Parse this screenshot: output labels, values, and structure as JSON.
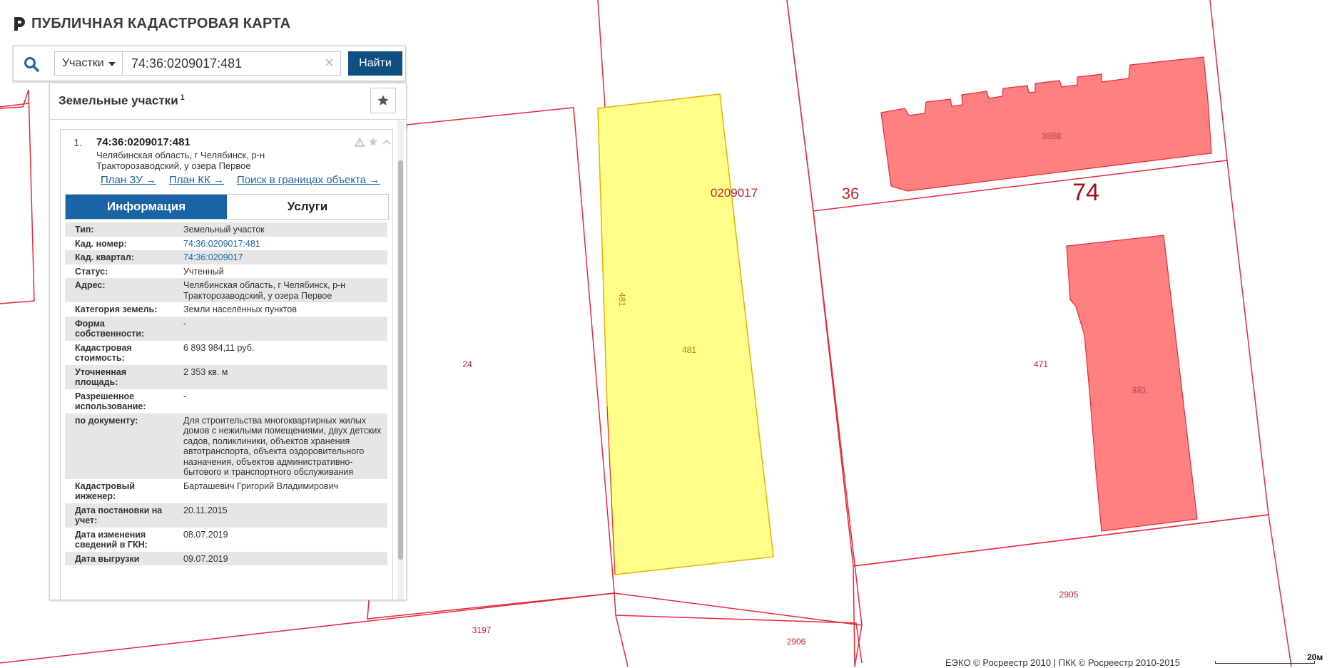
{
  "app": {
    "title": "ПУБЛИЧНАЯ КАДАСТРОВАЯ КАРТА"
  },
  "search": {
    "type_label": "Участки",
    "query": "74:36:0209017:481",
    "clear_symbol": "×",
    "find_label": "Найти"
  },
  "panel": {
    "title": "Земельные участки",
    "count": "1",
    "result": {
      "number": "1.",
      "cad_number": "74:36:0209017:481",
      "address": "Челябинская область, г Челябинск, р-н Тракторозаводский, у озера Первое",
      "links": [
        "План ЗУ →",
        "План КК →",
        "Поиск в границах объекта →"
      ]
    },
    "tabs": [
      {
        "label": "Информация",
        "active": true
      },
      {
        "label": "Услуги",
        "active": false
      }
    ],
    "info": [
      {
        "k": "Тип:",
        "v": "Земельный участок"
      },
      {
        "k": "Кад. номер:",
        "v": "74:36:0209017:481",
        "link": true
      },
      {
        "k": "Кад. квартал:",
        "v": "74:36:0209017",
        "link": true
      },
      {
        "k": "Статус:",
        "v": "Учтенный"
      },
      {
        "k": "Адрес:",
        "v": "Челябинская область, г Челябинск, р-н Тракторозаводский, у озера Первое"
      },
      {
        "k": "Категория земель:",
        "v": "Земли населённых пунктов"
      },
      {
        "k": "Форма собственности:",
        "v": "-"
      },
      {
        "k": "Кадастровая стоимость:",
        "v": "6 893 984,11 руб."
      },
      {
        "k": "Уточненная площадь:",
        "v": "2 353 кв. м"
      },
      {
        "k": "Разрешенное использование:",
        "v": "-"
      },
      {
        "k": "по документу:",
        "v": "Для строительства многоквартирных жилых домов с нежилыми помещениями, двух детских садов, поликлиники, объектов хранения автотранспорта, объекта оздоровительного назначения, объектов административно-бытового и транспортного обслуживания"
      },
      {
        "k": "Кадастровый инженер:",
        "v": "Барташевич Григорий Владимирович"
      },
      {
        "k": "Дата постановки на учет:",
        "v": "20.11.2015"
      },
      {
        "k": "Дата изменения сведений в ГКН:",
        "v": "08.07.2019"
      },
      {
        "k": "Дата выгрузки",
        "v": "09.07.2019"
      }
    ]
  },
  "map": {
    "colors": {
      "boundary": "#e8283a",
      "selected_fill": "#ffff8a",
      "building_fill": "#ff8080",
      "label": "#c0282e"
    },
    "labels": {
      "parcel_24": "24",
      "parcel_481_edge": "481",
      "parcel_481": "481",
      "block": "0209017",
      "district_36": "36",
      "region_74": "74",
      "building_3388": "3388",
      "parcel_471": "471",
      "building_991": "991",
      "parcel_3197": "3197",
      "parcel_2906": "2906",
      "parcel_2905": "2905"
    }
  },
  "footer": {
    "attribution": "ЕЭКО © Росреестр 2010 | ПКК © Росреестр 2010-2015",
    "scale": "20м"
  }
}
